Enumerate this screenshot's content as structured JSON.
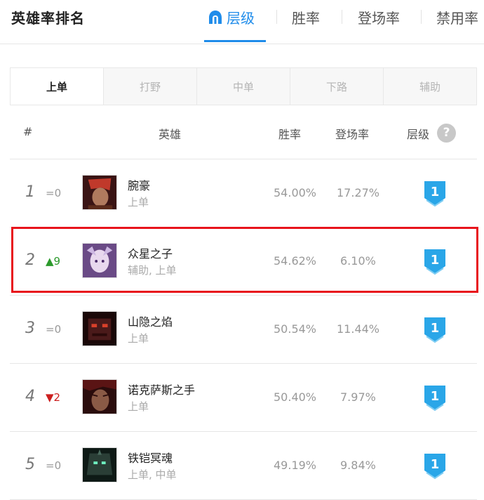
{
  "header": {
    "title": "英雄率排名",
    "tabs": [
      {
        "label": "层级",
        "active": true
      },
      {
        "label": "胜率",
        "active": false
      },
      {
        "label": "登场率",
        "active": false
      },
      {
        "label": "禁用率",
        "active": false
      }
    ]
  },
  "lanes": [
    "上单",
    "打野",
    "中单",
    "下路",
    "辅助"
  ],
  "columns": {
    "rank": "#",
    "hero": "英雄",
    "winrate": "胜率",
    "pickrate": "登场率",
    "tier": "层级",
    "help": "?"
  },
  "rows": [
    {
      "rank": "1",
      "trend": "=0",
      "trend_type": "same",
      "name": "腕豪",
      "lanes": "上单",
      "winrate": "54.00%",
      "pickrate": "17.27%",
      "tier": "1"
    },
    {
      "rank": "2",
      "trend": "▲9",
      "trend_type": "up",
      "name": "众星之子",
      "lanes": "辅助, 上单",
      "winrate": "54.62%",
      "pickrate": "6.10%",
      "tier": "1"
    },
    {
      "rank": "3",
      "trend": "=0",
      "trend_type": "same",
      "name": "山隐之焰",
      "lanes": "上单",
      "winrate": "50.54%",
      "pickrate": "11.44%",
      "tier": "1"
    },
    {
      "rank": "4",
      "trend": "▼2",
      "trend_type": "down",
      "name": "诺克萨斯之手",
      "lanes": "上单",
      "winrate": "50.40%",
      "pickrate": "7.97%",
      "tier": "1"
    },
    {
      "rank": "5",
      "trend": "=0",
      "trend_type": "same",
      "name": "铁铠冥魂",
      "lanes": "上单, 中单",
      "winrate": "49.19%",
      "pickrate": "9.84%",
      "tier": "1"
    }
  ],
  "colors": {
    "accent": "#1f8cea",
    "highlight": "#e8141c",
    "up": "#2c9a2c",
    "down": "#cc1f1f"
  }
}
